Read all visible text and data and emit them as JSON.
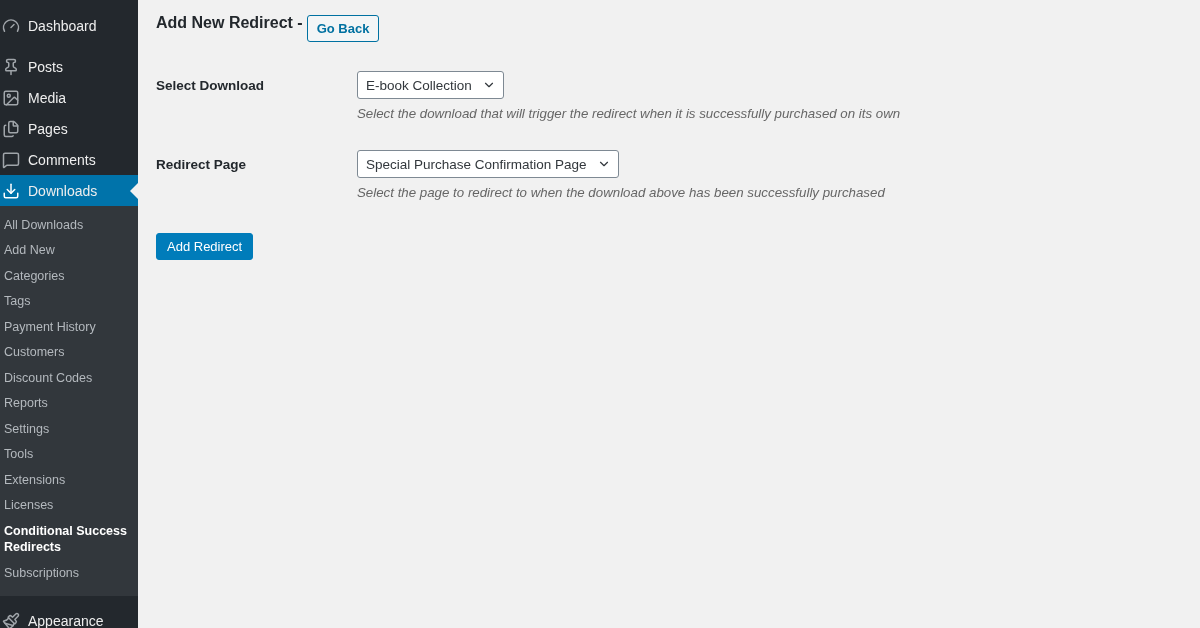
{
  "sidebar": {
    "items": [
      {
        "label": "Dashboard",
        "selected": false
      },
      {
        "label": "Posts",
        "selected": false
      },
      {
        "label": "Media",
        "selected": false
      },
      {
        "label": "Pages",
        "selected": false
      },
      {
        "label": "Comments",
        "selected": false
      },
      {
        "label": "Downloads",
        "selected": true,
        "children": [
          {
            "label": "All Downloads",
            "selected": false
          },
          {
            "label": "Add New",
            "selected": false
          },
          {
            "label": "Categories",
            "selected": false
          },
          {
            "label": "Tags",
            "selected": false
          },
          {
            "label": "Payment History",
            "selected": false
          },
          {
            "label": "Customers",
            "selected": false
          },
          {
            "label": "Discount Codes",
            "selected": false
          },
          {
            "label": "Reports",
            "selected": false
          },
          {
            "label": "Settings",
            "selected": false
          },
          {
            "label": "Tools",
            "selected": false
          },
          {
            "label": "Extensions",
            "selected": false
          },
          {
            "label": "Licenses",
            "selected": false
          },
          {
            "label": "Conditional Success Redirects",
            "selected": true
          },
          {
            "label": "Subscriptions",
            "selected": false
          }
        ]
      },
      {
        "label": "Appearance",
        "selected": false
      }
    ]
  },
  "page": {
    "title": "Add New Redirect -",
    "back_button": "Go Back",
    "fields": [
      {
        "label": "Select Download",
        "value": "E-book Collection",
        "description": "Select the download that will trigger the redirect when it is successfully purchased on its own"
      },
      {
        "label": "Redirect Page",
        "value": "Special Purchase Confirmation Page",
        "description": "Select the page to redirect to when the download above has been successfully purchased"
      }
    ],
    "submit_button": "Add Redirect"
  }
}
